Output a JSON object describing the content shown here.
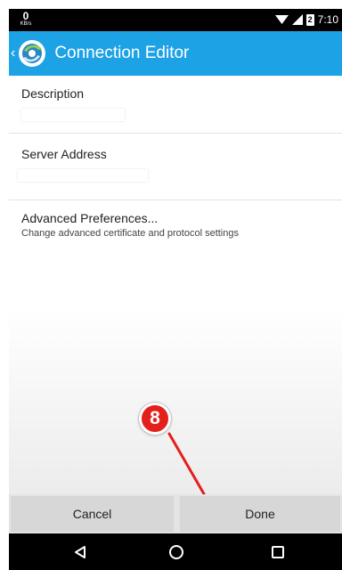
{
  "status_bar": {
    "speed_value": "0",
    "speed_unit": "KB/s",
    "battery_level": "2",
    "time": "7:10"
  },
  "app_bar": {
    "title": "Connection Editor",
    "icons": [
      "back-chevron-icon",
      "app-logo-icon"
    ],
    "color": "#1ea2e6"
  },
  "settings": {
    "description_label": "Description",
    "server_address_label": "Server Address",
    "advanced_title": "Advanced Preferences...",
    "advanced_summary": "Change advanced certificate and protocol settings"
  },
  "annotation": {
    "step_number": "8",
    "color": "#e3201b"
  },
  "buttons": {
    "cancel_label": "Cancel",
    "done_label": "Done"
  },
  "nav_bar": {
    "icons": [
      "back-triangle-icon",
      "home-circle-icon",
      "recents-square-icon"
    ]
  }
}
